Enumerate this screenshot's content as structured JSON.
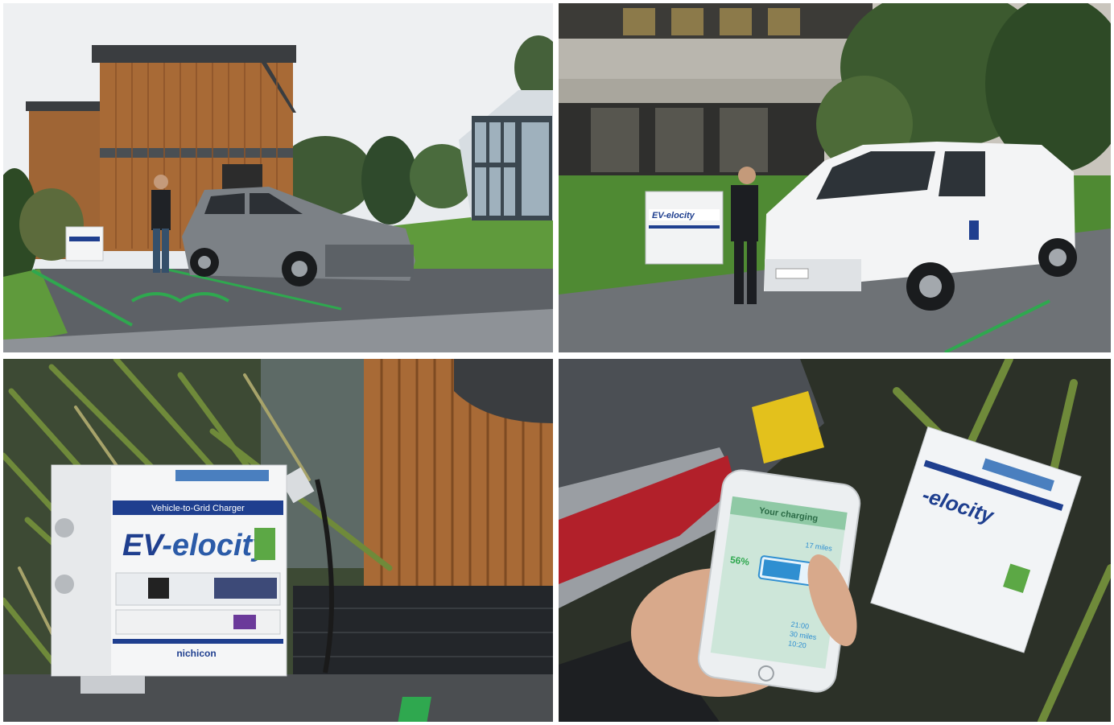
{
  "collage": {
    "panels": [
      {
        "id": "p1",
        "subject": "suv-charging-at-wooden-building"
      },
      {
        "id": "p2",
        "subject": "van-charging-at-office-building"
      },
      {
        "id": "p3",
        "subject": "charger-unit-closeup"
      },
      {
        "id": "p4",
        "subject": "phone-charging-app"
      }
    ]
  },
  "charger": {
    "brand_prefix": "EV",
    "brand_suffix": "-elocity",
    "subtitle": "Vehicle-to-Grid Charger",
    "maker": "nichicon"
  },
  "van": {
    "brand_prefix": "EV",
    "brand_suffix": "-elocity"
  },
  "phone_app": {
    "header": "Your charging",
    "percent": "56%",
    "range_1": "17 miles",
    "range_2": "21:00",
    "range_3": "30 miles",
    "range_4": "10:20"
  },
  "colors": {
    "accent_green": "#2fa84f",
    "brand_blue": "#1f3f8f",
    "wood": "#a86a36"
  }
}
